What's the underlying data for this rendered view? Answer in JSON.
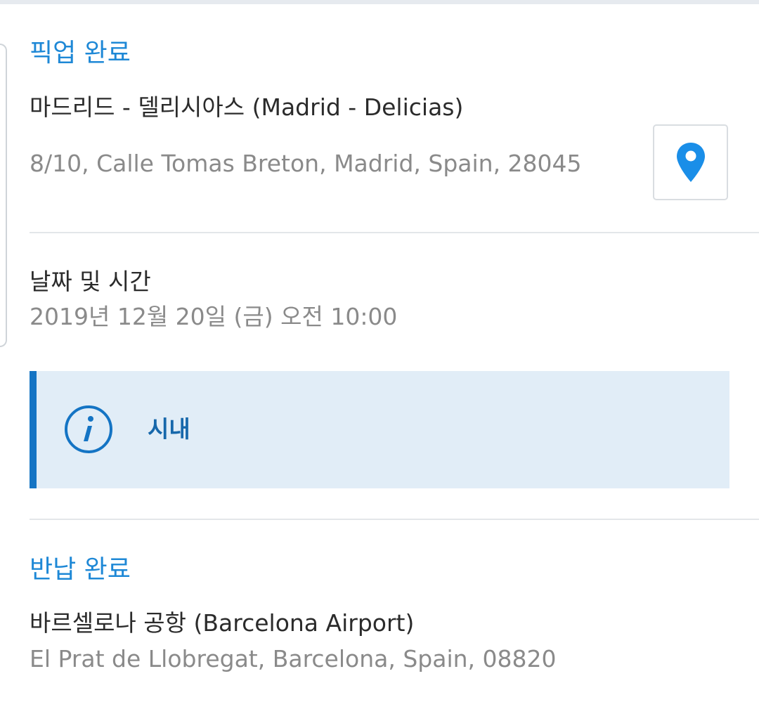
{
  "pickup": {
    "title": "픽업 완료",
    "location_name": "마드리드 - 델리시아스 (Madrid - Delicias)",
    "address": "8/10, Calle Tomas Breton, Madrid, Spain, 28045",
    "map_icon": "map-pin-icon"
  },
  "datetime": {
    "label": "날짜 및 시간",
    "value": "2019년 12월 20일 (금) 오전 10:00"
  },
  "info_notice": {
    "icon": "info-icon",
    "text": "시내"
  },
  "return": {
    "title": "반납 완료",
    "location_name": "바르셀로나 공항 (Barcelona Airport)",
    "address": "El Prat de Llobregat, Barcelona, Spain, 08820"
  },
  "colors": {
    "accent_blue": "#1e88d6",
    "pin_blue": "#1a8ee8",
    "info_bg": "#e1edf7",
    "info_bar": "#1474c4",
    "info_text": "#1768ab"
  }
}
